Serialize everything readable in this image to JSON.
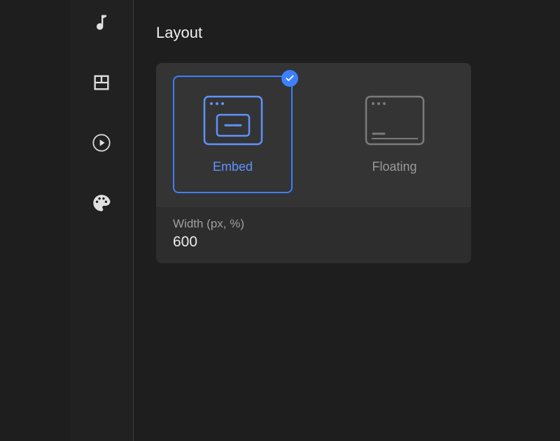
{
  "section": {
    "title": "Layout"
  },
  "sidebar": {
    "items": [
      {
        "name": "music-icon"
      },
      {
        "name": "layout-icon"
      },
      {
        "name": "play-icon"
      },
      {
        "name": "palette-icon"
      }
    ]
  },
  "layout": {
    "options": [
      {
        "label": "Embed",
        "selected": true
      },
      {
        "label": "Floating",
        "selected": false
      }
    ],
    "width": {
      "label": "Width (px, %)",
      "value": "600"
    }
  },
  "colors": {
    "accent": "#3d7fff"
  }
}
